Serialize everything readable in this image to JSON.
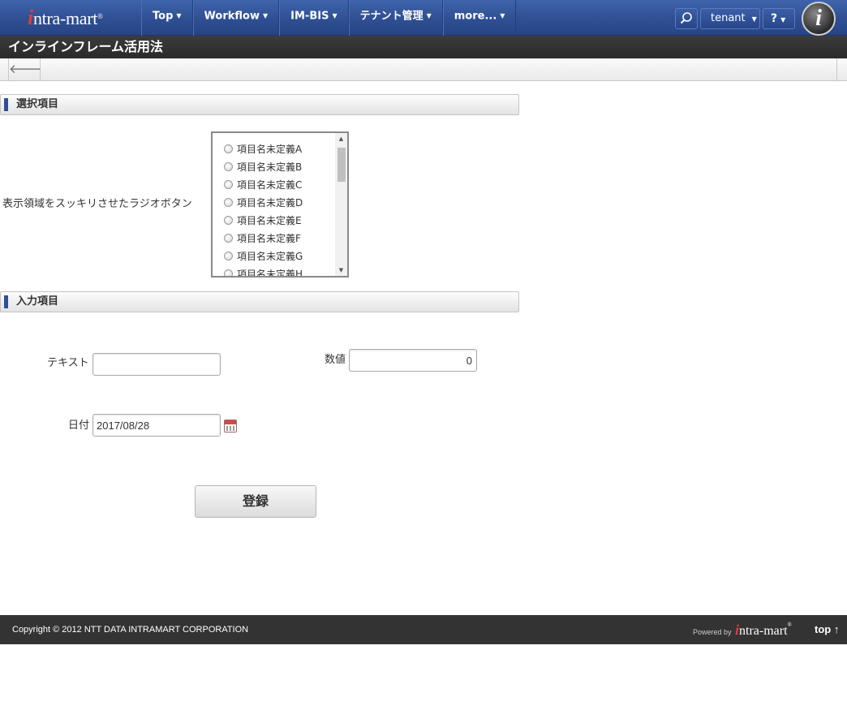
{
  "header": {
    "logo_text": "intra-mart",
    "nav": [
      {
        "label": "Top"
      },
      {
        "label": "Workflow"
      },
      {
        "label": "IM-BIS"
      },
      {
        "label": "テナント管理"
      },
      {
        "label": "more..."
      }
    ],
    "tenant_label": "tenant",
    "help_label": "?"
  },
  "page": {
    "title": "インラインフレーム活用法"
  },
  "section_select": {
    "title": "選択項目",
    "radio_label": "表示領域をスッキリさせたラジオボタン",
    "options": [
      "項目名未定義A",
      "項目名未定義B",
      "項目名未定義C",
      "項目名未定義D",
      "項目名未定義E",
      "項目名未定義F",
      "項目名未定義G",
      "項目名未定義H"
    ]
  },
  "section_input": {
    "title": "入力項目",
    "text_label": "テキスト",
    "text_value": "",
    "number_label": "数値",
    "number_value": "0",
    "date_label": "日付",
    "date_value": "2017/08/28"
  },
  "actions": {
    "submit_label": "登録"
  },
  "footer": {
    "copyright": "Copyright © 2012 NTT DATA INTRAMART CORPORATION",
    "powered_by": "Powered by",
    "logo_text": "intra-mart",
    "top_link": "top ↑"
  },
  "colors": {
    "nav_blue": "#2f4f93",
    "title_bar": "#333333",
    "footer": "#333333",
    "accent_red": "#e03a3a"
  }
}
